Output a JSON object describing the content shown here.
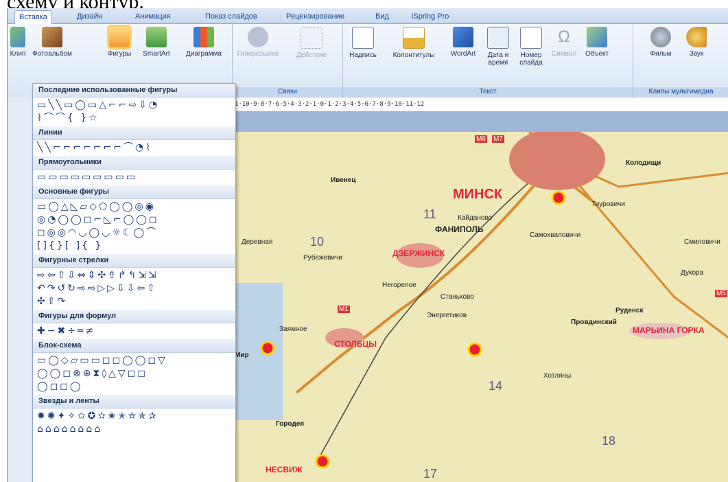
{
  "top_text": "схему и контур.",
  "tabs": [
    "Вставка",
    "Дизайн",
    "Анимация",
    "Показ слайдов",
    "Рецензирование",
    "Вид",
    "iSpring Pro"
  ],
  "ribbon": {
    "clip": "Клип",
    "photoalbum": "Фотоальбом",
    "shapes": "Фигуры",
    "smartart": "SmartArt",
    "chart": "Диаграмма",
    "hyperlink": "Гиперссылка",
    "action": "Действие",
    "links_group": "Связи",
    "textbox": "Надпись",
    "header": "Колонтитулы",
    "wordart": "WordArt",
    "datetime_1": "Дата и",
    "datetime_2": "время",
    "slidenum_1": "Номер",
    "slidenum_2": "слайда",
    "symbol": "Символ",
    "object": "Объект",
    "text_group": "Текст",
    "movie": "Фильм",
    "sound": "Звук",
    "media_group": "Клипы мультимедиа"
  },
  "shapes_panel": {
    "sections": [
      {
        "title": "Последние использованные фигуры",
        "rows": [
          "▭╲╲▭◯▭△⌐⌐⇨⇩◔",
          "⌇⌒⌒{ }☆"
        ]
      },
      {
        "title": "Линии",
        "rows": [
          "╲╲⌐⌐⌐⌐⌐⌐⌐⌒◔⌇"
        ]
      },
      {
        "title": "Прямоугольники",
        "rows": [
          "▭▭▭▭▭▭▭▭▭"
        ]
      },
      {
        "title": "Основные фигуры",
        "rows": [
          "▭◯△◺▱◇⬠◯◯◎◉",
          "◎◔◯◯◻⌐◺⌐◯◯◻",
          "◻◎◎◠◡◯◡☼☾◯⌒",
          "[]{}[ ]{ }"
        ]
      },
      {
        "title": "Фигурные стрелки",
        "rows": [
          "⇨⇦⇧⇩⇔⇕✣⇮↱↰⇲⇲",
          "↶↷↺↻⇨⇨▷▷⇩⇩⇦⇧",
          "✣⇧↷"
        ]
      },
      {
        "title": "Фигуры для формул",
        "rows": [
          "✚−✖÷═≠"
        ]
      },
      {
        "title": "Блок-схема",
        "rows": [
          "▭◯◇▱▭▭◻◻◯◯◻▽",
          "◯◯◻⊗⊕⧗◊△▽◻◻",
          "◯◻◻◯"
        ]
      },
      {
        "title": "Звезды и ленты",
        "rows": [
          "✹✺✦✧✩✪✫✬✭✮✯✰",
          "⌂⌂⌂⌂⌂⌂⌂⌂"
        ]
      }
    ]
  },
  "ruler": "1·10·9·8·7·6·5·4·3·2·1·0·1·2·3·4·5·6·7·8·9·10·11·12",
  "map": {
    "minsk": "МИНСК",
    "fanipol": "ФАНИПОЛЬ",
    "dzerzhinsk": "ДЗЕРЖИНСК",
    "stolbtsy": "СТОЛБЦЫ",
    "nesvizh": "НЕСВИЖ",
    "marina_gorka": "МАРЬИНА ГОРКА",
    "ivenets": "Ивенец",
    "koldishchi": "Колодищи",
    "rudensk": "Руденск",
    "provodinsky": "Провдинский",
    "stankovo": "Станьково",
    "energetikov": "Энергетиков",
    "negoreloe": "Негорелое",
    "rubezhevichi": "Рубежевичи",
    "mir": "Мир",
    "gorodeya": "Городея",
    "samokhvalovichi": "Самохваловичи",
    "zameche": "Заямное",
    "derevnaya": "Деревная",
    "khotlyany": "Хотляны",
    "dukora": "Дукора",
    "smilovichi": "Смиловичи",
    "road_m1": "M1",
    "road_m6": "M6",
    "road_m7": "M7",
    "road_m5": "M5",
    "n10": "10",
    "n11": "11",
    "n14": "14",
    "n17": "17",
    "n18": "18",
    "koidanovo": "Кайданово",
    "turkovo": "Тиуровичи"
  }
}
